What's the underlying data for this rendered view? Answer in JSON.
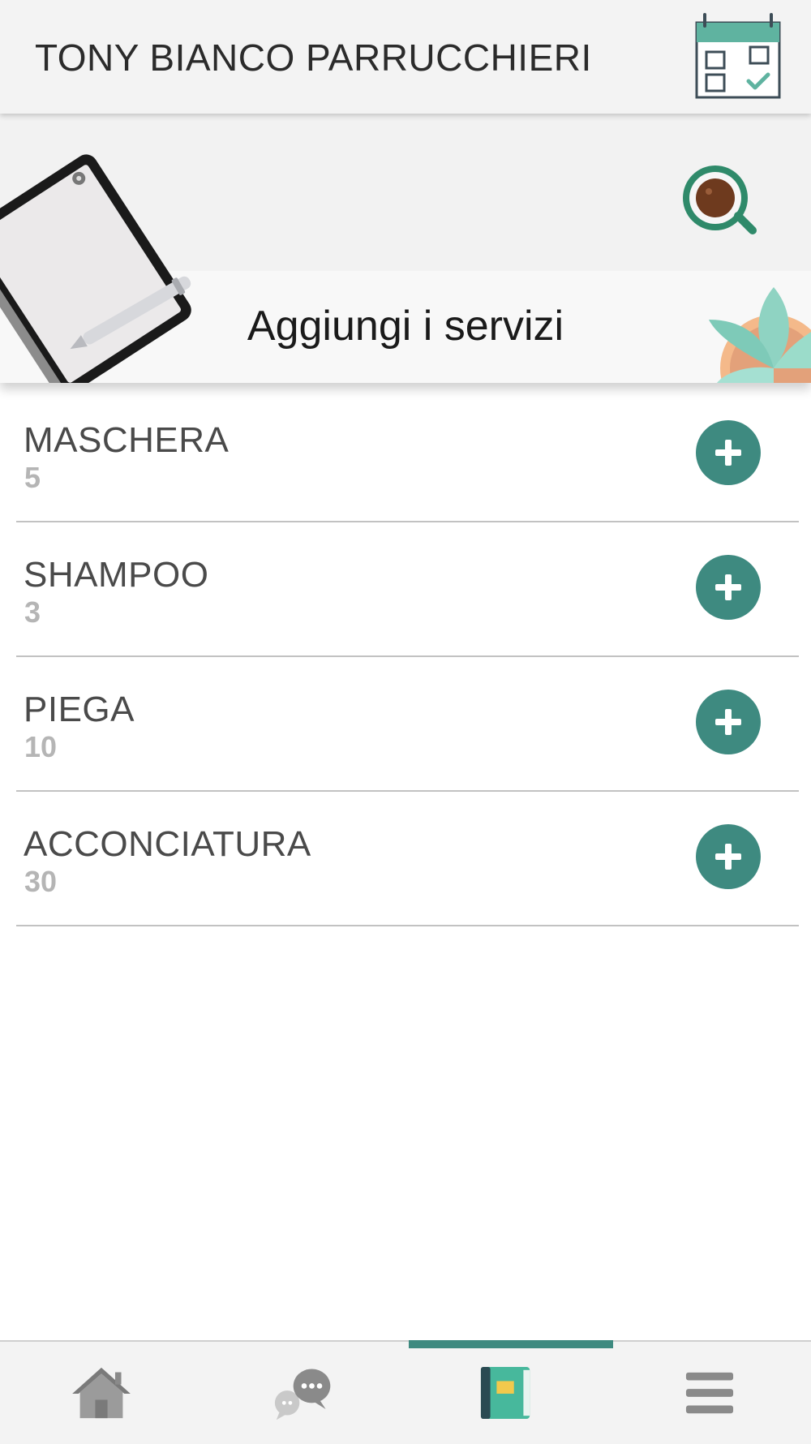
{
  "header": {
    "title": "TONY BIANCO PARRUCCHIERI",
    "calendar_icon": "calendar-check-icon"
  },
  "banner": {
    "title": "Aggiungi i servizi"
  },
  "services": [
    {
      "name": "MASCHERA",
      "value": "5"
    },
    {
      "name": "SHAMPOO",
      "value": "3"
    },
    {
      "name": "PIEGA",
      "value": "10"
    },
    {
      "name": "ACCONCIATURA",
      "value": "30"
    }
  ],
  "bottom_nav": {
    "items": [
      {
        "icon": "home-icon"
      },
      {
        "icon": "chat-icon"
      },
      {
        "icon": "notebook-icon",
        "active": true
      },
      {
        "icon": "menu-icon"
      }
    ]
  },
  "colors": {
    "accent": "#3e8a80",
    "header_bg": "#f3f3f3",
    "divider": "#c2c2c2",
    "value_text": "#b5b5b5"
  }
}
